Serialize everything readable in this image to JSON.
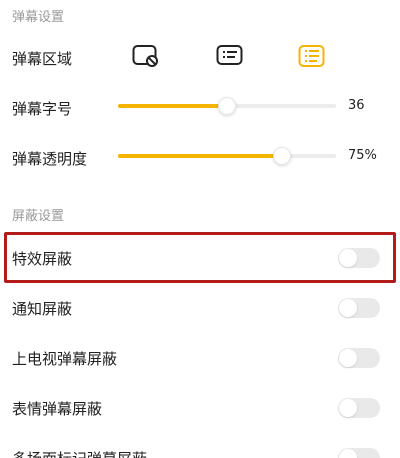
{
  "danmaku_settings": {
    "section_title": "弹幕设置",
    "area": {
      "label": "弹幕区域",
      "options": [
        {
          "icon": "no-danmaku-screen-icon",
          "selected": false
        },
        {
          "icon": "partial-danmaku-screen-icon",
          "selected": false
        },
        {
          "icon": "full-danmaku-screen-icon",
          "selected": true
        }
      ]
    },
    "font_size": {
      "label": "弹幕字号",
      "value": "36",
      "level_fraction": 0.5
    },
    "opacity": {
      "label": "弹幕透明度",
      "value": "75%",
      "level_fraction": 0.75
    }
  },
  "shield_settings": {
    "section_title": "屏蔽设置",
    "items": [
      {
        "label": "特效屏蔽",
        "enabled": false,
        "highlighted": true
      },
      {
        "label": "通知屏蔽",
        "enabled": false
      },
      {
        "label": "上电视弹幕屏蔽",
        "enabled": false
      },
      {
        "label": "表情弹幕屏蔽",
        "enabled": false
      },
      {
        "label": "多场面标记弹幕屏蔽",
        "enabled": false
      }
    ]
  },
  "colors": {
    "accent": "#f4b400",
    "highlight_border": "#b31b1b",
    "toggle_off": "#e9e9e9"
  }
}
